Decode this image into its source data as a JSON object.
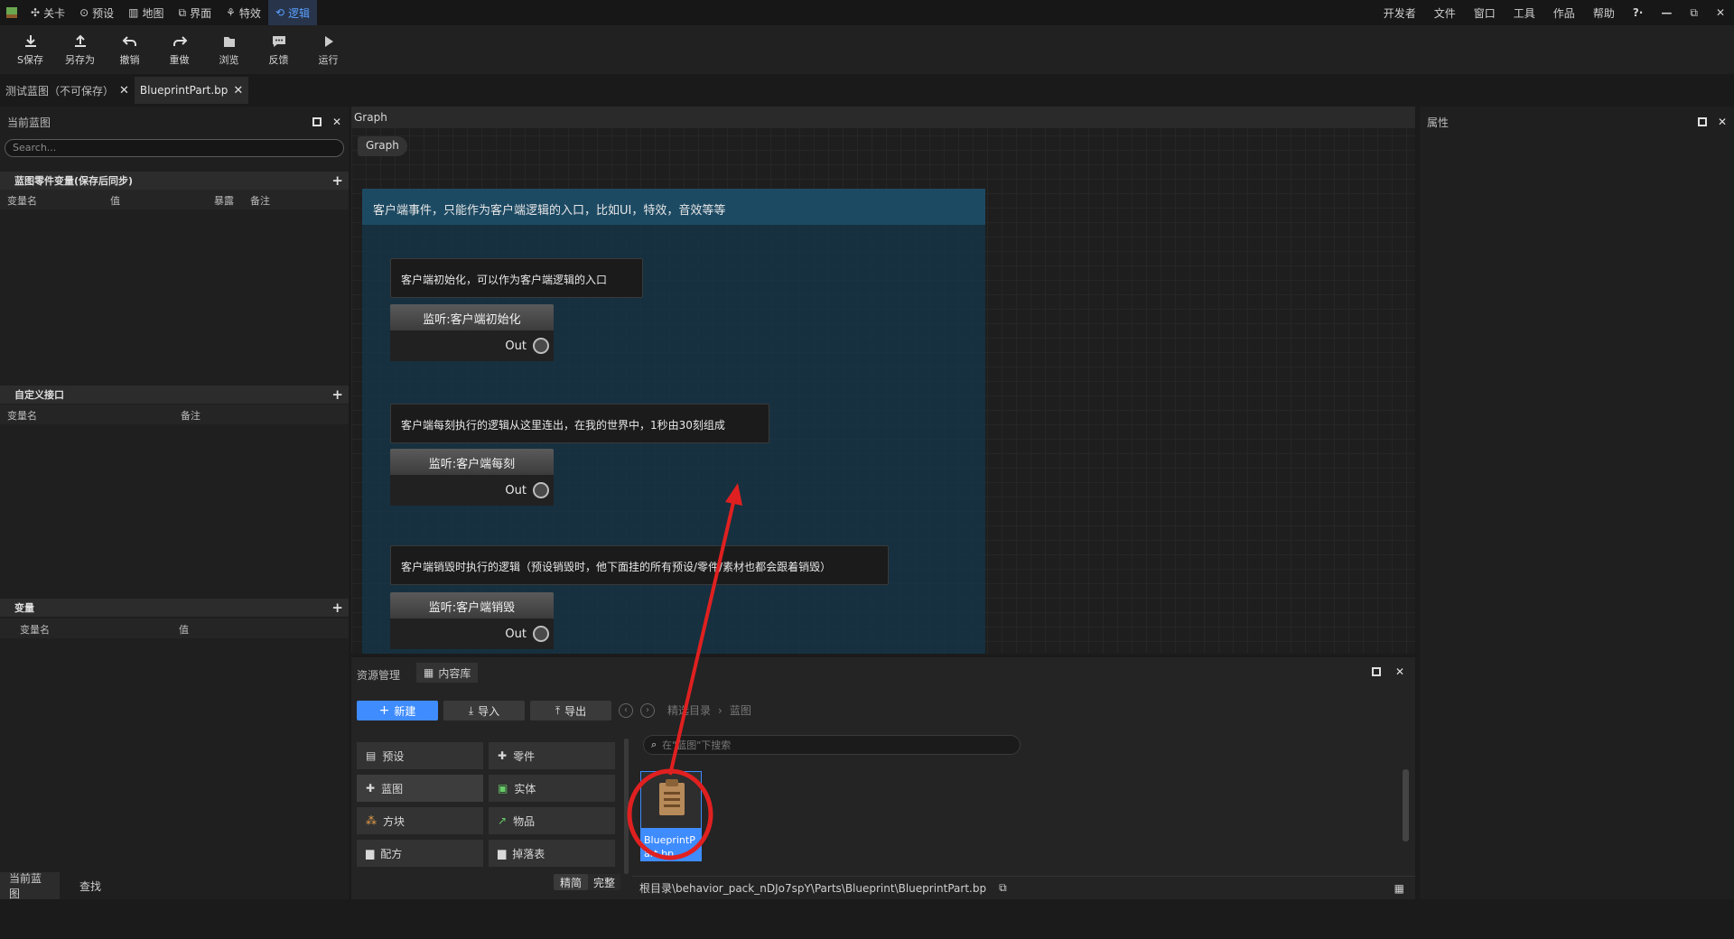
{
  "menu": {
    "tabs": [
      {
        "icon": "level-icon",
        "label": "关卡"
      },
      {
        "icon": "preset-icon",
        "label": "预设"
      },
      {
        "icon": "map-icon",
        "label": "地图"
      },
      {
        "icon": "ui-icon",
        "label": "界面"
      },
      {
        "icon": "effects-icon",
        "label": "特效"
      },
      {
        "icon": "logic-icon",
        "label": "逻辑"
      }
    ],
    "right": [
      "开发者",
      "文件",
      "窗口",
      "工具",
      "作品",
      "帮助",
      "?·"
    ]
  },
  "toolbar": {
    "save": "S保存",
    "save_as": "另存为",
    "undo": "撤销",
    "redo": "重做",
    "browse": "浏览",
    "feedback": "反馈",
    "run": "运行"
  },
  "doc_tabs": [
    {
      "label": "测试蓝图（不可保存）",
      "close": "✕"
    },
    {
      "label": "BlueprintPart.bp",
      "close": "✕"
    }
  ],
  "left_panel": {
    "title": "当前蓝图",
    "search_placeholder": "Search...",
    "sections": {
      "event_vars": {
        "title": "蓝图零件变量(保存后同步)",
        "cols": [
          "变量名",
          "值",
          "暴露",
          "备注"
        ]
      },
      "custom_iface": {
        "title": "自定义接口",
        "cols": [
          "变量名",
          "备注"
        ]
      },
      "vars": {
        "title": "变量",
        "cols": [
          "变量名",
          "值"
        ]
      }
    },
    "bottom_tabs": [
      "当前蓝图",
      "查找"
    ]
  },
  "graph": {
    "header": "Graph",
    "breadcrumb": "Graph",
    "comment_title": "客户端事件，只能作为客户端逻辑的入口，比如UI，特效，音效等等",
    "blocks": [
      {
        "label": "客户端初始化，可以作为客户端逻辑的入口",
        "node": "监听:客户端初始化",
        "pin": "Out"
      },
      {
        "label": "客户端每刻执行的逻辑从这里连出，在我的世界中，1秒由30刻组成",
        "node": "监听:客户端每刻",
        "pin": "Out"
      },
      {
        "label": "客户端销毁时执行的逻辑（预设销毁时，他下面挂的所有预设/零件/素材也都会跟着销毁）",
        "node": "监听:客户端销毁",
        "pin": "Out"
      }
    ]
  },
  "properties": {
    "title": "属性"
  },
  "assets": {
    "tab_manage": "资源管理",
    "tab_library": "内容库",
    "new": "新建",
    "import": "导入",
    "export": "导出",
    "path_root": "精选目录",
    "path_current": "蓝图",
    "search_placeholder": "在\"蓝图\"下搜索",
    "categories": [
      {
        "icon": "preset-icon",
        "label": "预设"
      },
      {
        "icon": "part-icon",
        "label": "零件"
      },
      {
        "icon": "blueprint-icon",
        "label": "蓝图"
      },
      {
        "icon": "entity-icon",
        "label": "实体"
      },
      {
        "icon": "block-icon",
        "label": "方块"
      },
      {
        "icon": "item-icon",
        "label": "物品"
      },
      {
        "icon": "recipe-icon",
        "label": "配方"
      },
      {
        "icon": "loot-table-icon",
        "label": "掉落表"
      }
    ],
    "view_simple": "精简",
    "view_full": "完整",
    "file_name": "BlueprintPart.bp",
    "file_path": "根目录\\behavior_pack_nDJo7spY\\Parts\\Blueprint\\BlueprintPart.bp"
  },
  "colors": {
    "accent": "#3f8cff",
    "annotation": "#e02020",
    "comment_bg": "#173c52"
  }
}
